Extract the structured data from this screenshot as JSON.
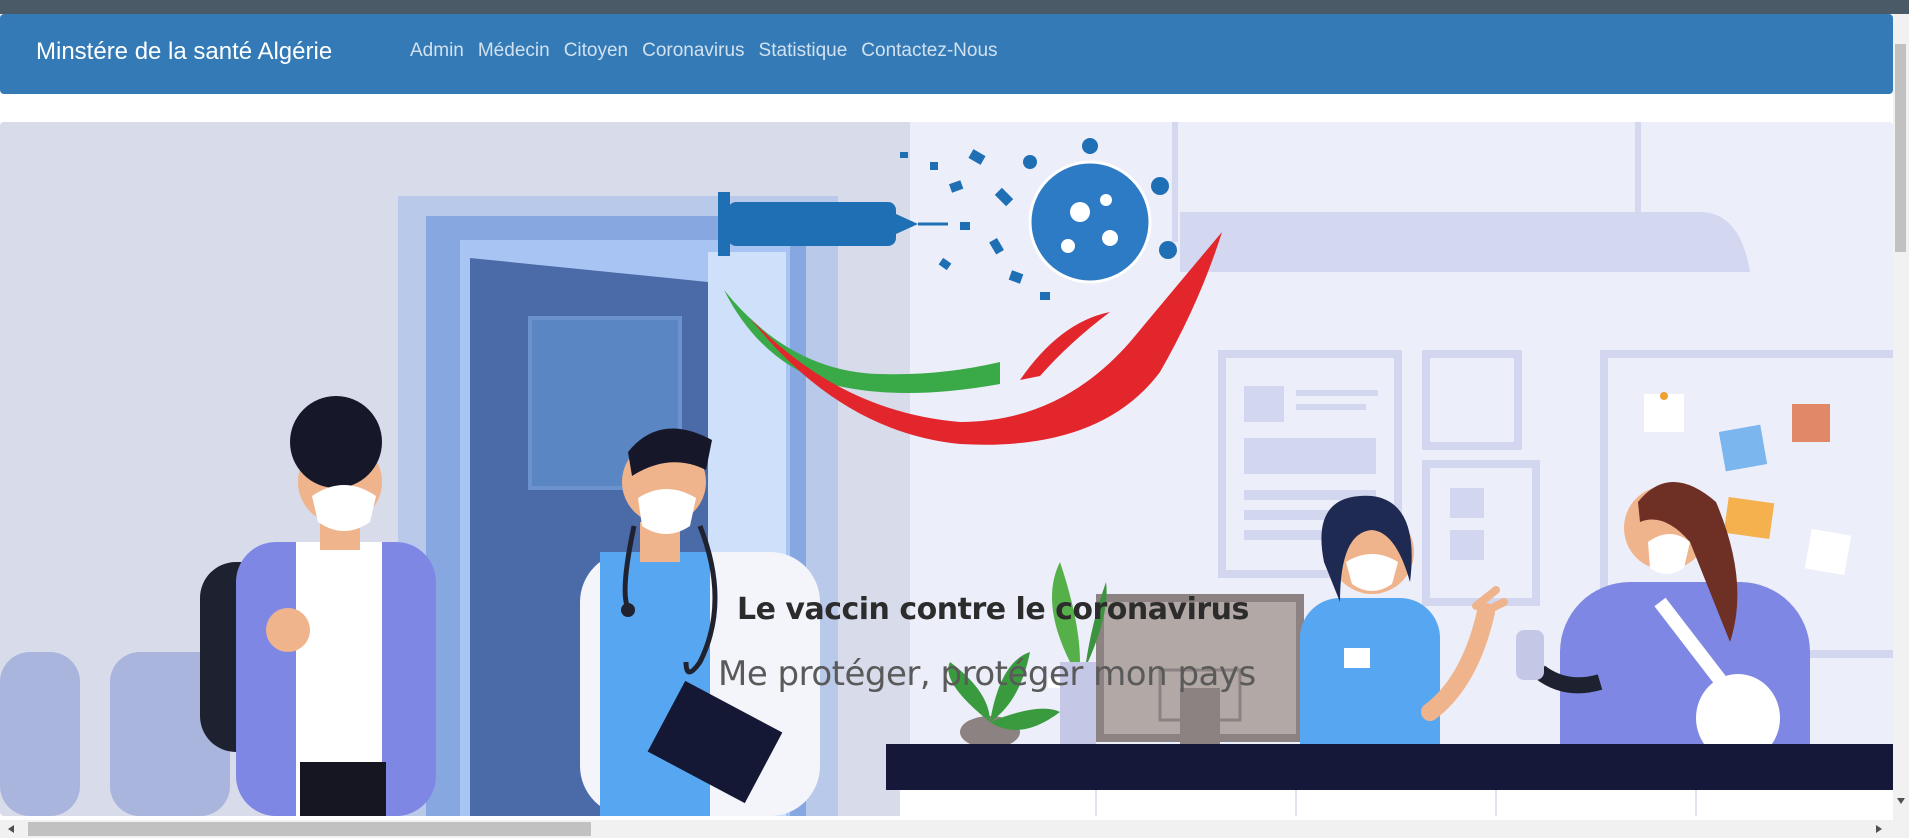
{
  "window": {
    "title": ""
  },
  "navbar": {
    "brand": "Minstére de la santé Algérie",
    "links": [
      {
        "label": "Admin"
      },
      {
        "label": "Médecin"
      },
      {
        "label": "Citoyen"
      },
      {
        "label": "Coronavirus"
      },
      {
        "label": "Statistique"
      },
      {
        "label": "Contactez-Nous"
      }
    ]
  },
  "hero": {
    "headline": "Le vaccin contre le coronavirus",
    "tagline": "Me protéger, protéger mon pays",
    "illustration": "clinic-reception-illustration",
    "logo": "vaccine-hand-logo"
  },
  "colors": {
    "navbar": "#337ab7",
    "nav_link": "#d2e1ef",
    "logo_red": "#e3262b",
    "logo_green": "#3aaa48",
    "logo_blue": "#1f6fb5"
  }
}
